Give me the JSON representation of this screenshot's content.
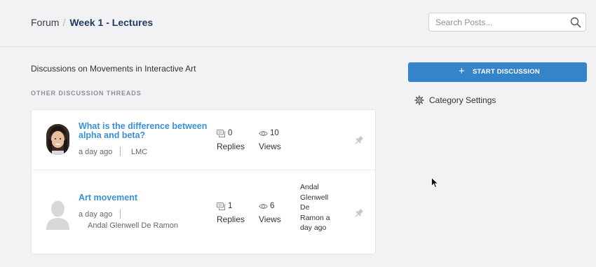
{
  "breadcrumb": {
    "root": "Forum",
    "separator": "/",
    "current": "Week 1 - Lectures"
  },
  "search": {
    "placeholder": "Search Posts...",
    "icon": "search-icon"
  },
  "category": {
    "description": "Discussions on Movements in Interactive Art"
  },
  "section_label": "OTHER DISCUSSION THREADS",
  "threads": [
    {
      "title": "What is the difference between alpha and beta?",
      "time": "a day ago",
      "author": "LMC",
      "replies": "0",
      "replies_label": "Replies",
      "views": "10",
      "views_label": "Views",
      "last_activity": "",
      "avatar": "user-photo",
      "pin_icon": "pin-icon"
    },
    {
      "title": "Art movement",
      "time": "a day ago",
      "author": "Andal Glenwell De Ramon",
      "replies": "1",
      "replies_label": "Replies",
      "views": "6",
      "views_label": "Views",
      "last_activity": "Andal Glenwell De Ramon a day ago",
      "avatar": "default-avatar",
      "pin_icon": "pin-icon"
    }
  ],
  "sidebar": {
    "start_button_icon": "plus-icon",
    "start_button_label": "START DISCUSSION",
    "settings_icon": "gear-icon",
    "settings_label": "Category Settings"
  },
  "colors": {
    "accent": "#3584c9",
    "link": "#3a8fd9",
    "breadcrumb_current": "#1f3a5f",
    "background": "#f2f2f4"
  }
}
